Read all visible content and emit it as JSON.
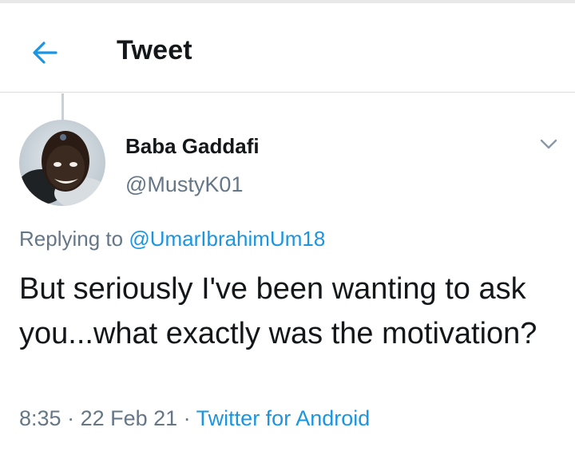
{
  "header": {
    "back_icon": "arrow-left-icon",
    "title": "Tweet",
    "accent_color": "#1b95e0"
  },
  "tweet": {
    "author": {
      "display_name": "Baba Gaddafi",
      "handle": "@MustyK01",
      "avatar_icon": "profile-photo"
    },
    "menu_icon": "chevron-down-icon",
    "replying_prefix": "Replying to ",
    "replying_to": "@UmarIbrahimUm18",
    "text": "But seriously I've been wanting to ask you...what exactly was the motivation?",
    "time": "8:35",
    "date": "22 Feb 21",
    "separator": " · ",
    "source": "Twitter for Android"
  }
}
